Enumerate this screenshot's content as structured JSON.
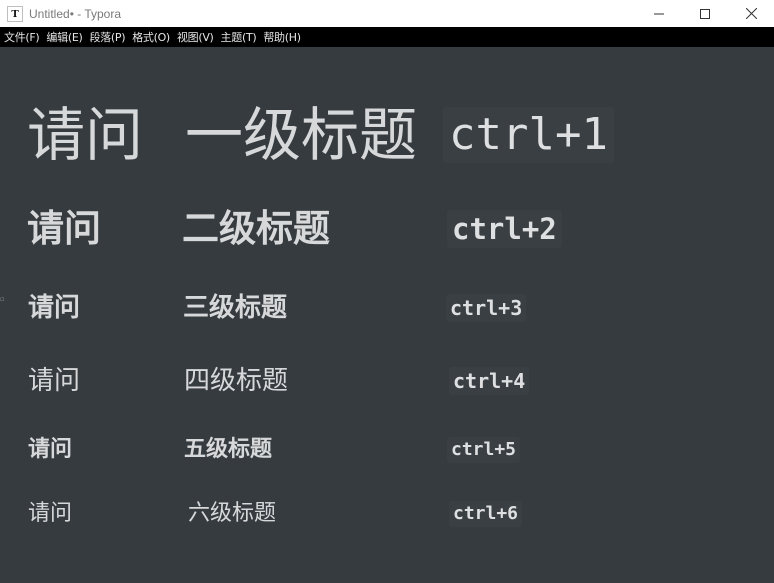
{
  "window": {
    "app_icon_letter": "T",
    "title": "Untitled• - Typora",
    "controls": [
      {
        "name": "minimize-button",
        "icon": "minimize-icon"
      },
      {
        "name": "maximize-button",
        "icon": "maximize-icon"
      },
      {
        "name": "close-button",
        "icon": "close-icon"
      }
    ]
  },
  "menu": {
    "items": [
      "文件(F)",
      "编辑(E)",
      "段落(P)",
      "格式(O)",
      "视图(V)",
      "主题(T)",
      "帮助(H)"
    ]
  },
  "headings": [
    {
      "level": 1,
      "question": "请问",
      "label": "一级标题",
      "shortcut": "ctrl+1"
    },
    {
      "level": 2,
      "question": "请问",
      "label": "二级标题",
      "shortcut": "ctrl+2"
    },
    {
      "level": 3,
      "question": "请问",
      "label": "三级标题",
      "shortcut": "ctrl+3"
    },
    {
      "level": 4,
      "question": "请问",
      "label": "四级标题",
      "shortcut": "ctrl+4"
    },
    {
      "level": 5,
      "question": "请问",
      "label": "五级标题",
      "shortcut": "ctrl+5"
    },
    {
      "level": 6,
      "question": "请问",
      "label": "六级标题",
      "shortcut": "ctrl+6"
    }
  ],
  "colors": {
    "editor_background": "#363B40",
    "heading_text": "#D7D8D9",
    "code_background": "#3A3F44",
    "menubar_background": "#000000",
    "titlebar_background": "#FFFFFF"
  }
}
